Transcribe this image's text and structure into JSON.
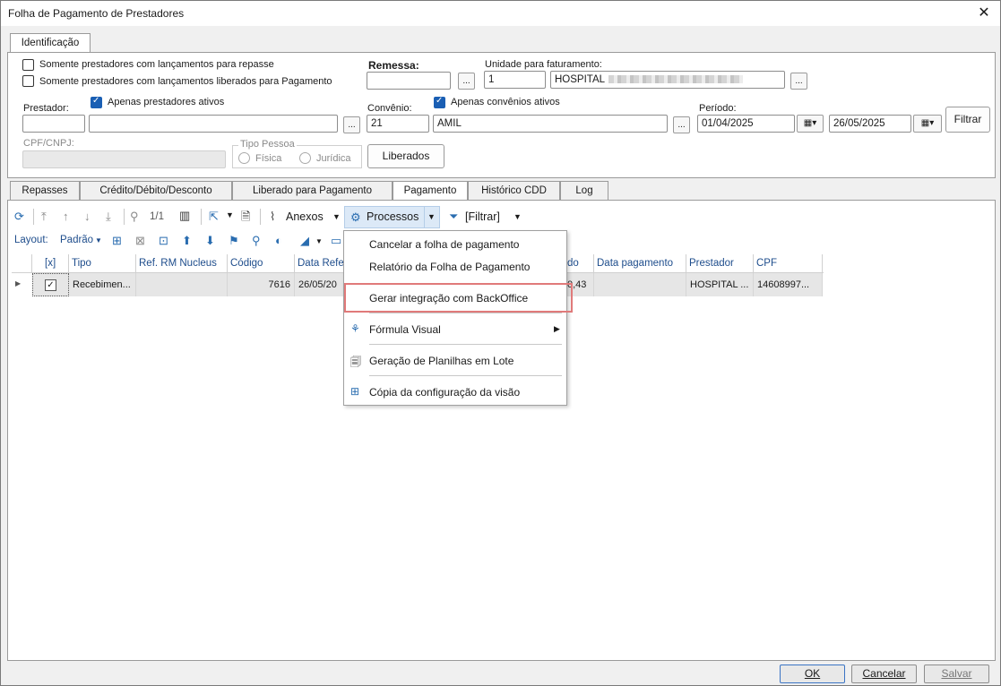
{
  "window": {
    "title": "Folha de Pagamento de Prestadores",
    "close": "✕"
  },
  "top_tab": "Identificação",
  "filters": {
    "chk_repasse": "Somente prestadores com lançamentos para repasse",
    "chk_liberados": "Somente prestadores com lançamentos liberados para Pagamento",
    "remessa_label": "Remessa:",
    "unidade_label": "Unidade para faturamento:",
    "unidade_code": "1",
    "unidade_name": "HOSPITAL",
    "prestador_label": "Prestador:",
    "apenas_prestadores": "Apenas prestadores ativos",
    "convenio_label": "Convênio:",
    "apenas_convenios": "Apenas convênios ativos",
    "convenio_code": "21",
    "convenio_name": "AMIL",
    "periodo_label": "Período:",
    "periodo_inicio": "01/04/2025",
    "periodo_fim": "26/05/2025",
    "filtrar_button": "Filtrar",
    "cpf_label": "CPF/CNPJ:",
    "tipo_pessoa_label": "Tipo Pessoa",
    "fisica": "Física",
    "juridica": "Jurídica",
    "liberados_button": "Liberados",
    "dots": "..."
  },
  "tabs": [
    "Repasses",
    "Crédito/Débito/Desconto",
    "Liberado para Pagamento",
    "Pagamento",
    "Histórico CDD",
    "Log"
  ],
  "toolbar": {
    "page": "1/1",
    "anexos": "Anexos",
    "processos": "Processos",
    "filtrar": "[Filtrar]",
    "layout_label": "Layout:",
    "layout_value": "Padrão"
  },
  "grid": {
    "headers": [
      "[x]",
      "Tipo",
      "Ref. RM Nucleus",
      "Código",
      "Data Refer",
      "do",
      "Data pagamento",
      "Prestador",
      "CPF"
    ],
    "row": {
      "tipo": "Recebimen...",
      "ref": "",
      "codigo": "7616",
      "data_ref": "26/05/20",
      "valor": "0,43",
      "data_pag": "",
      "prestador": "HOSPITAL ...",
      "cpf": "14608997..."
    }
  },
  "menu": {
    "items": [
      "Cancelar a folha de pagamento",
      "Relatório da Folha de Pagamento",
      "Gerar integração com BackOffice",
      "Fórmula Visual",
      "Geração de Planilhas em Lote",
      "Cópia da configuração da visão"
    ]
  },
  "footer": {
    "ok": "OK",
    "cancelar": "Cancelar",
    "salvar": "Salvar"
  }
}
